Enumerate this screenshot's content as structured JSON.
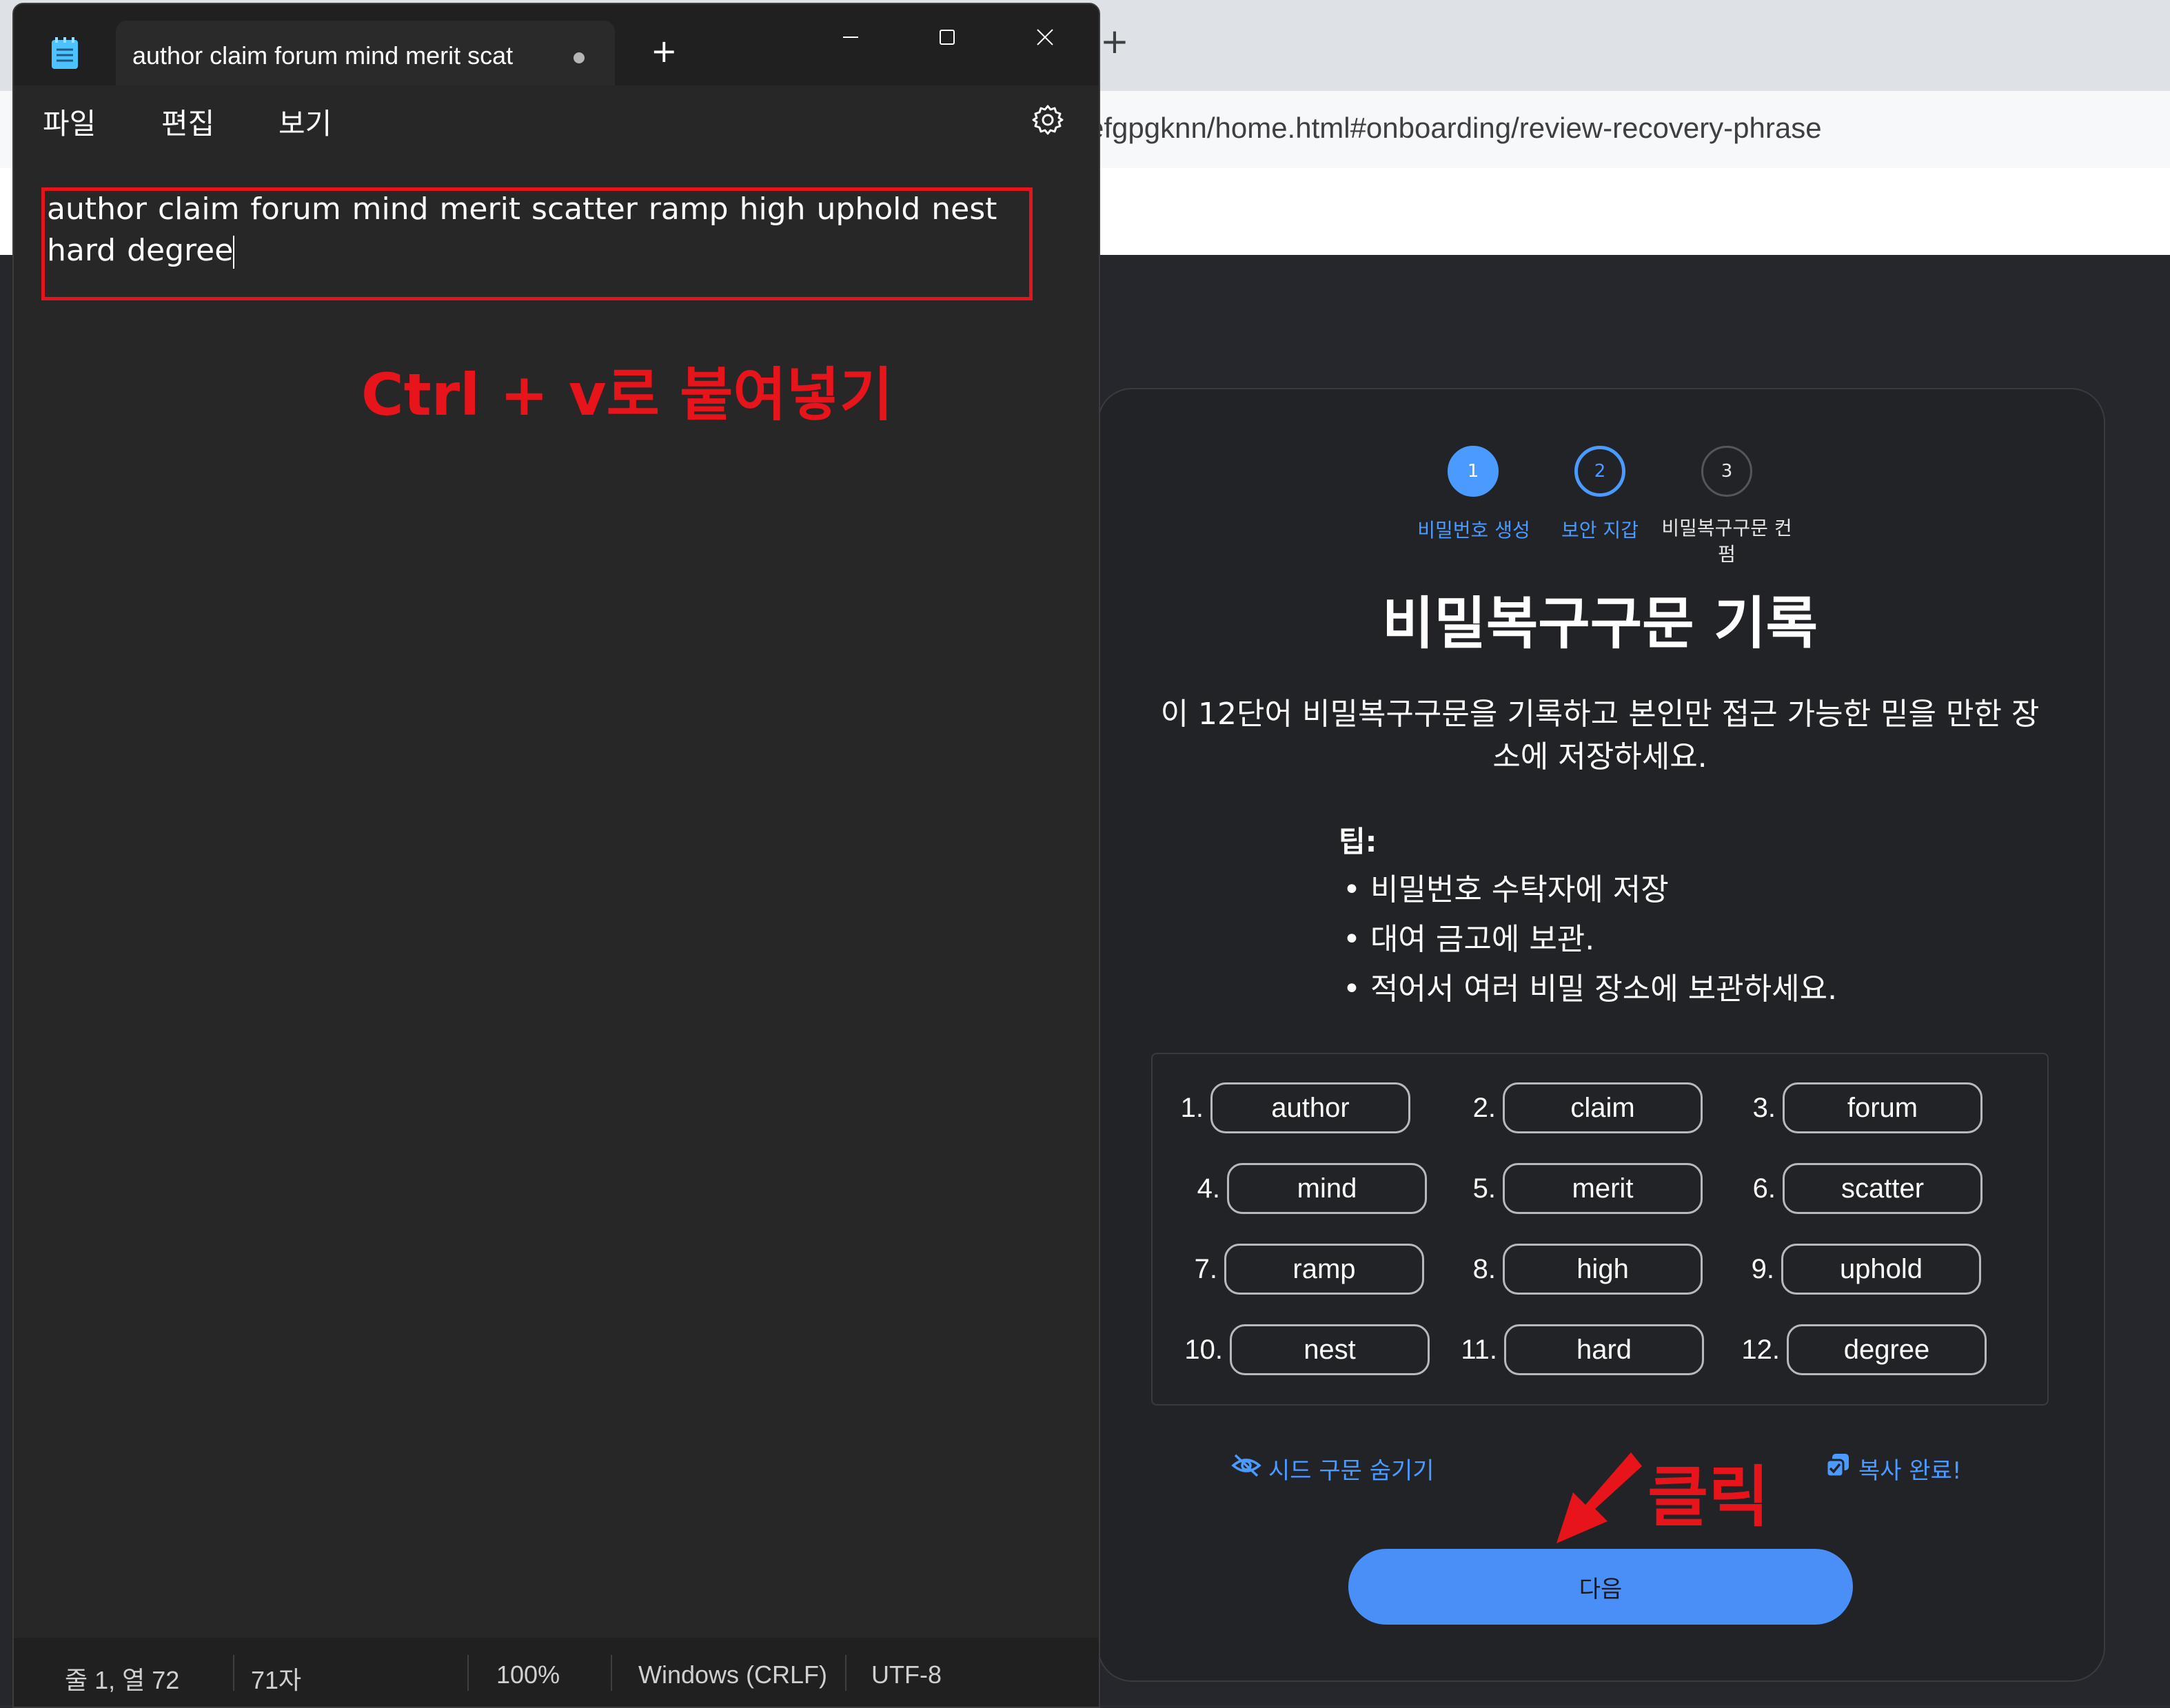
{
  "browser": {
    "url": "efgpgknn/home.html#onboarding/review-recovery-phrase",
    "new_tab_symbol": "+"
  },
  "metamask": {
    "steps": [
      {
        "number": "1",
        "label": "비밀번호 생성"
      },
      {
        "number": "2",
        "label": "보안 지갑"
      },
      {
        "number": "3",
        "label": "비밀복구구문 컨펌"
      }
    ],
    "title": "비밀복구구문 기록",
    "description": "이 12단어 비밀복구구문을 기록하고 본인만 접근 가능한 믿을 만한 장소에 저장하세요.",
    "tips_title": "팁:",
    "tips": [
      "비밀번호 수탁자에 저장",
      "대여 금고에 보관.",
      "적어서 여러 비밀 장소에 보관하세요."
    ],
    "words": [
      {
        "num": "1.",
        "word": "author"
      },
      {
        "num": "2.",
        "word": "claim"
      },
      {
        "num": "3.",
        "word": "forum"
      },
      {
        "num": "4.",
        "word": "mind"
      },
      {
        "num": "5.",
        "word": "merit"
      },
      {
        "num": "6.",
        "word": "scatter"
      },
      {
        "num": "7.",
        "word": "ramp"
      },
      {
        "num": "8.",
        "word": "high"
      },
      {
        "num": "9.",
        "word": "uphold"
      },
      {
        "num": "10.",
        "word": "nest"
      },
      {
        "num": "11.",
        "word": "hard"
      },
      {
        "num": "12.",
        "word": "degree"
      }
    ],
    "hide_label": "시드 구문 숨기기",
    "copy_label": "복사 완료!",
    "next_label": "다음",
    "accent_color": "#4a9aff"
  },
  "annotations": {
    "click": "클릭",
    "paste": "Ctrl + v로 붙여넣기",
    "color": "#e8141b"
  },
  "notepad": {
    "tab_title": "author claim forum mind merit scat",
    "new_tab_symbol": "+",
    "menu": [
      "파일",
      "편집",
      "보기"
    ],
    "content": "author claim forum mind merit scatter ramp high uphold nest hard degree",
    "status": {
      "position": "줄 1, 열 72",
      "chars": "71자",
      "zoom": "100%",
      "line_ending": "Windows (CRLF)",
      "encoding": "UTF-8"
    }
  }
}
